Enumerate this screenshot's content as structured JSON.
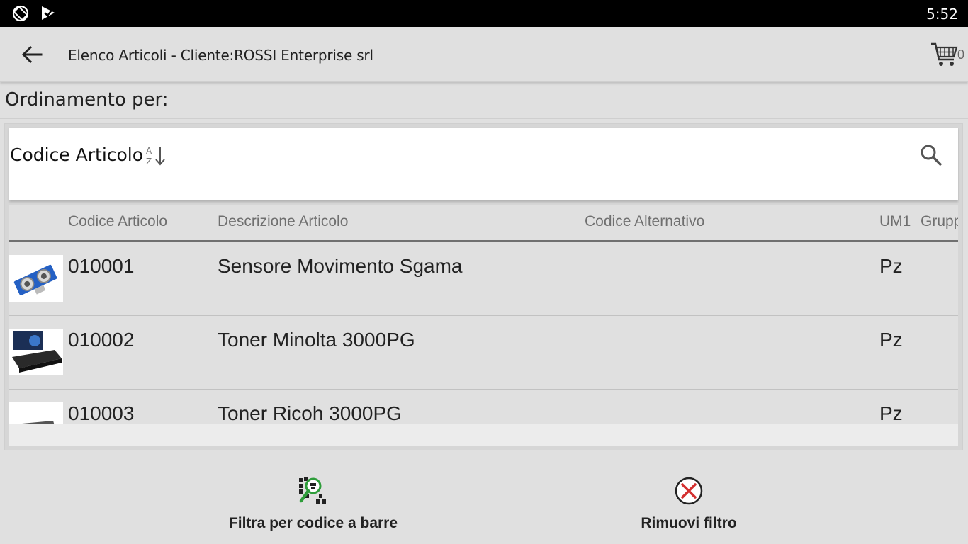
{
  "status_bar": {
    "time": "5:52"
  },
  "app_bar": {
    "title": "Elenco Articoli - Cliente:ROSSI Enterprise srl",
    "cart_count": "0"
  },
  "sort": {
    "label": "Ordinamento per:",
    "field": "Codice Articolo"
  },
  "table": {
    "headers": [
      "Codice Articolo",
      "Descrizione Articolo",
      "Codice Alternativo",
      "UM1",
      "Grupp"
    ],
    "rows": [
      {
        "code": "010001",
        "description": "Sensore Movimento Sgama",
        "alt_code": "",
        "um": "Pz"
      },
      {
        "code": "010002",
        "description": "Toner Minolta 3000PG",
        "alt_code": "",
        "um": "Pz"
      },
      {
        "code": "010003",
        "description": "Toner Ricoh 3000PG",
        "alt_code": "",
        "um": "Pz"
      }
    ]
  },
  "bottom_bar": {
    "barcode_filter_label": "Filtra per codice a barre",
    "remove_filter_label": "Rimuovi filtro"
  },
  "colors": {
    "accent_green": "#2e9d3a",
    "remove_red": "#d32f2f"
  }
}
